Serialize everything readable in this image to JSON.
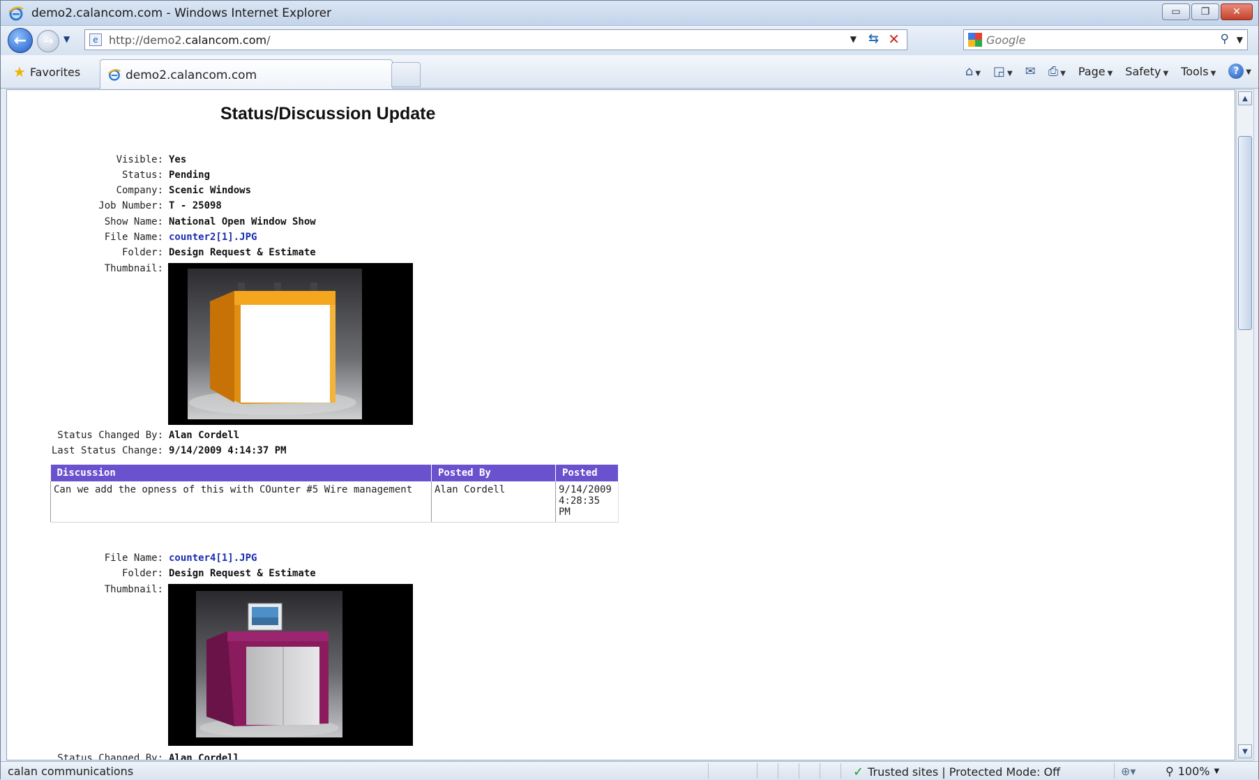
{
  "window": {
    "title": "demo2.calancom.com - Windows Internet Explorer",
    "minimize": "▭",
    "restore": "❐",
    "close": "✕"
  },
  "address": {
    "url_prefix": "http://demo2.",
    "url_domain": "calancom.com",
    "url_suffix": "/",
    "search_placeholder": "Google"
  },
  "tabs": {
    "favorites_label": "Favorites",
    "active_tab_title": "demo2.calancom.com"
  },
  "commandbar": {
    "page_label": "Page",
    "safety_label": "Safety",
    "tools_label": "Tools"
  },
  "page": {
    "heading": "Status/Discussion Update",
    "record1": {
      "visible_label": "Visible:",
      "visible_value": "Yes",
      "status_label": "Status:",
      "status_value": "Pending",
      "company_label": "Company:",
      "company_value": "Scenic Windows",
      "job_label": "Job Number:",
      "job_value": "T - 25098",
      "show_label": "Show Name:",
      "show_value": "National Open Window Show",
      "file_label": "File Name:",
      "file_value": "counter2[1].JPG",
      "folder_label": "Folder:",
      "folder_value": "Design Request & Estimate",
      "thumb_label": "Thumbnail:",
      "changed_by_label": "Status Changed By:",
      "changed_by_value": "Alan Cordell",
      "last_change_label": "Last Status Change:",
      "last_change_value": "9/14/2009 4:14:37 PM"
    },
    "discussion": {
      "headers": [
        "Discussion",
        "Posted By",
        "Posted"
      ],
      "rows": [
        {
          "discussion": "Can we add the opness of this with COunter #5 Wire management",
          "posted_by": "Alan Cordell",
          "posted": "9/14/2009 4:28:35 PM"
        }
      ]
    },
    "record2": {
      "file_label": "File Name:",
      "file_value": "counter4[1].JPG",
      "folder_label": "Folder:",
      "folder_value": "Design Request & Estimate",
      "thumb_label": "Thumbnail:",
      "changed_by_label": "Status Changed By:",
      "changed_by_value": "Alan Cordell"
    }
  },
  "statusbar": {
    "left_text": "calan communications",
    "zone_text": "Trusted sites | Protected Mode: Off",
    "zoom_text": "100%"
  },
  "colors": {
    "table_header": "#6a52cf",
    "link": "#1b2db0",
    "counter1_accent": "#f3a411",
    "counter2_accent": "#8a1c5e"
  }
}
